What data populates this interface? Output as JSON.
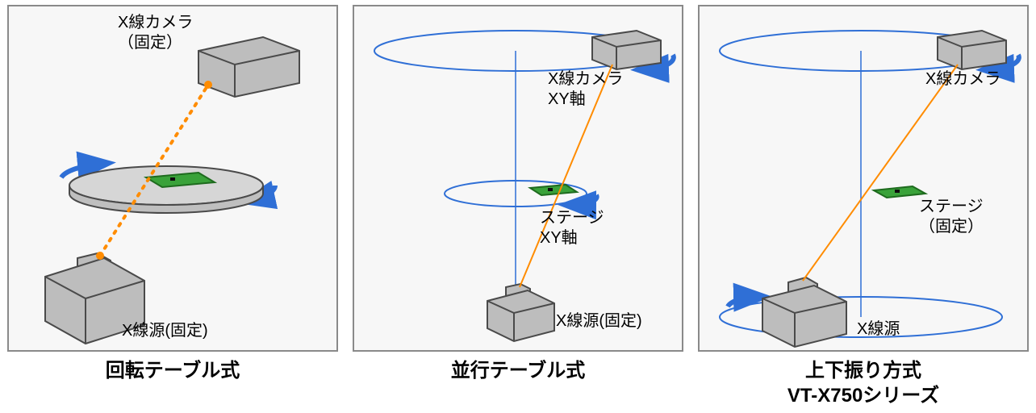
{
  "panels": [
    {
      "caption": "回転テーブル式",
      "camera_label": "X線カメラ\n（固定）",
      "source_label": "X線源(固定)",
      "stage_label": null
    },
    {
      "caption": "並行テーブル式",
      "camera_label": "X線カメラ\nXY軸",
      "source_label": "X線源(固定)",
      "stage_label": "ステージ\nXY軸"
    },
    {
      "caption": "上下振り方式\nVT-X750シリーズ",
      "camera_label": "X線カメラ",
      "source_label": "X線源",
      "stage_label": "ステージ\n（固定）"
    }
  ],
  "colors": {
    "blue": "#2f6fd6",
    "orange": "#ff8c00",
    "gray": "#a9a9a9",
    "grayD": "#5a5a5a",
    "green": "#3aa23a",
    "greenD": "#1e6b1e"
  }
}
